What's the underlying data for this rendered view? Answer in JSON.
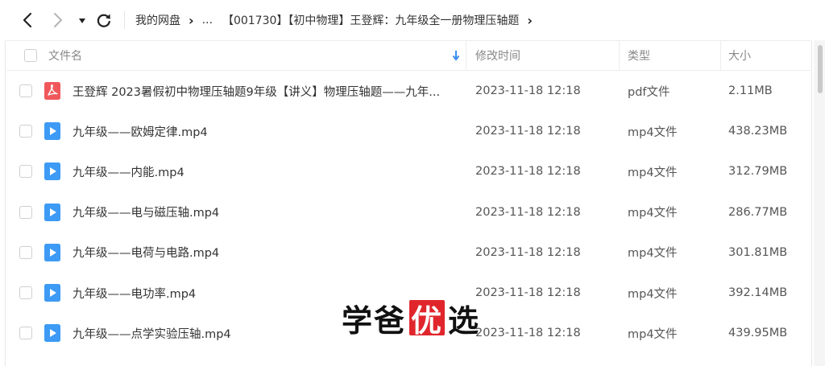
{
  "nav": {
    "breadcrumb": {
      "root": "我的网盘",
      "ellipsis": "...",
      "current": "【001730】【初中物理】王登辉：九年级全一册物理压轴题"
    }
  },
  "table": {
    "columns": {
      "name": "文件名",
      "modified": "修改时间",
      "type": "类型",
      "size": "大小"
    },
    "rows": [
      {
        "name": "王登辉 2023暑假初中物理压轴题9年级【讲义】物理压轴题——九年...",
        "modified": "2023-11-18 12:18",
        "type": "pdf文件",
        "size": "2.11MB",
        "icon": "pdf-icon"
      },
      {
        "name": "九年级——欧姆定律.mp4",
        "modified": "2023-11-18 12:18",
        "type": "mp4文件",
        "size": "438.23MB",
        "icon": "video-icon"
      },
      {
        "name": "九年级——内能.mp4",
        "modified": "2023-11-18 12:18",
        "type": "mp4文件",
        "size": "312.79MB",
        "icon": "video-icon"
      },
      {
        "name": "九年级——电与磁压轴.mp4",
        "modified": "2023-11-18 12:18",
        "type": "mp4文件",
        "size": "286.77MB",
        "icon": "video-icon"
      },
      {
        "name": "九年级——电荷与电路.mp4",
        "modified": "2023-11-18 12:18",
        "type": "mp4文件",
        "size": "301.81MB",
        "icon": "video-icon"
      },
      {
        "name": "九年级——电功率.mp4",
        "modified": "2023-11-18 12:18",
        "type": "mp4文件",
        "size": "392.14MB",
        "icon": "video-icon"
      },
      {
        "name": "九年级——点学实验压轴.mp4",
        "modified": "2023-11-18 12:18",
        "type": "mp4文件",
        "size": "439.95MB",
        "icon": "video-icon"
      }
    ]
  },
  "watermark": {
    "part1": "学爸",
    "badge": "优",
    "part2": "选"
  },
  "colors": {
    "pdf": "#f0575b",
    "video": "#3d9af5",
    "sort_arrow": "#3a8ef0",
    "watermark_badge": "#e0262c"
  }
}
